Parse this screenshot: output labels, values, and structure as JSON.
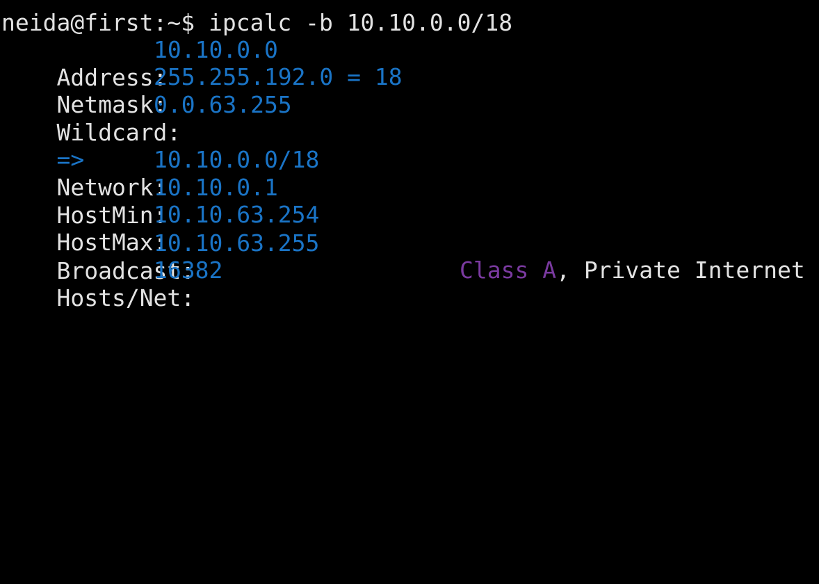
{
  "terminal": {
    "prompt": "neida@first:~$ ",
    "command": "ipcalc -b 10.10.0.0/18",
    "colors": {
      "background": "#000000",
      "text": "#e2e2e2",
      "value": "#1a74c6",
      "class": "#7a3aa0"
    },
    "rows": {
      "address": {
        "label": "Address:",
        "value": "10.10.0.0"
      },
      "netmask": {
        "label": "Netmask:",
        "value": "255.255.192.0 = 18"
      },
      "wildcard": {
        "label": "Wildcard:",
        "value": "0.0.63.255"
      },
      "arrow": "=>",
      "network": {
        "label": "Network:",
        "value": "10.10.0.0/18"
      },
      "hostmin": {
        "label": "HostMin:",
        "value": "10.10.0.1"
      },
      "hostmax": {
        "label": "HostMax:",
        "value": "10.10.63.254"
      },
      "broadcast": {
        "label": "Broadcast:",
        "value": "10.10.63.255"
      },
      "hostsnet": {
        "label": "Hosts/Net:",
        "value": "16382"
      }
    },
    "class_info": {
      "class_label": "Class A",
      "rest": ", Private Internet"
    }
  }
}
